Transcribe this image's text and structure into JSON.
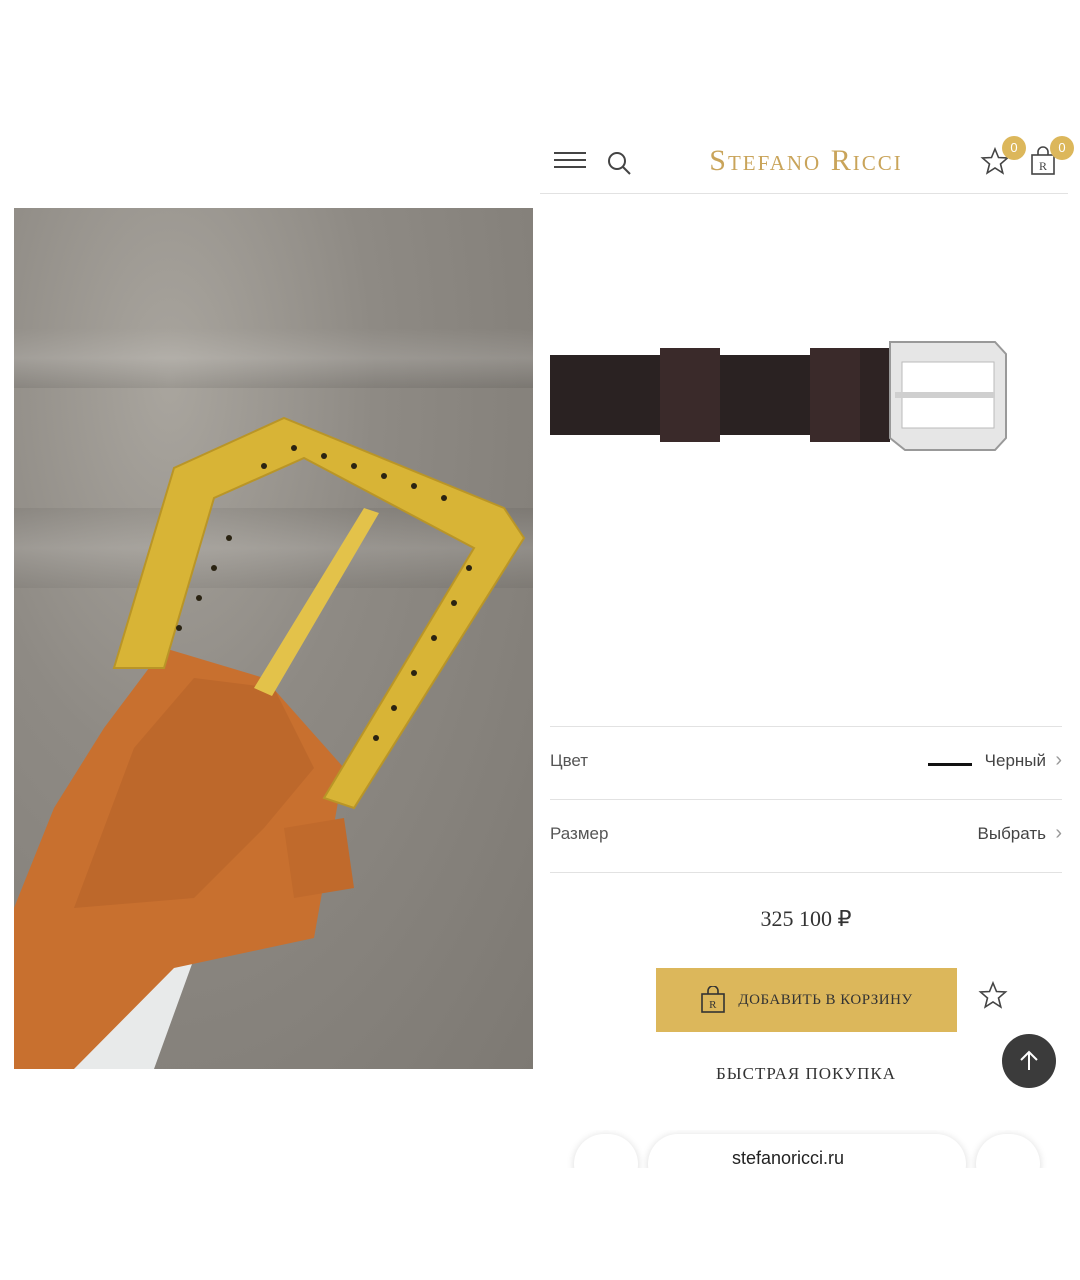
{
  "photo": {
    "icon": "belt-buckle-photo"
  },
  "header": {
    "logo": "Stefano Ricci",
    "favorites_count": "0",
    "cart_count": "0"
  },
  "product": {
    "options": {
      "color_label": "Цвет",
      "color_value": "Черный",
      "size_label": "Размер",
      "size_value": "Выбрать"
    },
    "price": "325 100 ₽",
    "add_to_cart": "ДОБАВИТЬ В КОРЗИНУ",
    "quick_buy": "БЫСТРАЯ ПОКУПКА"
  },
  "browser": {
    "url": "stefanoricci.ru"
  },
  "colors": {
    "accent": "#dcb75b",
    "logo": "#c9a45a"
  }
}
